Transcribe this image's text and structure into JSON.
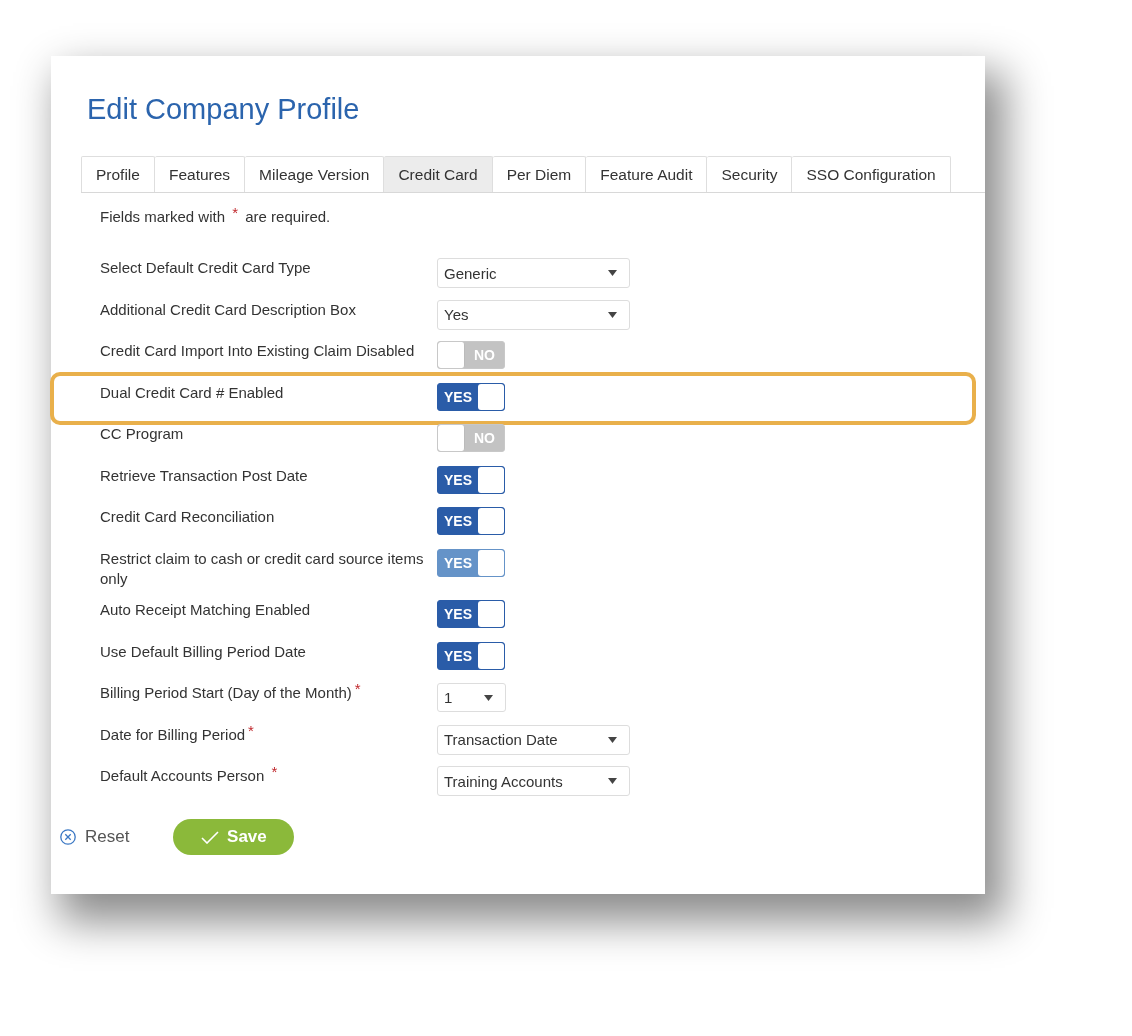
{
  "title": "Edit Company Profile",
  "tabs": [
    {
      "label": "Profile",
      "selected": false
    },
    {
      "label": "Features",
      "selected": false
    },
    {
      "label": "Mileage Version",
      "selected": false
    },
    {
      "label": "Credit Card",
      "selected": true
    },
    {
      "label": "Per Diem",
      "selected": false
    },
    {
      "label": "Feature Audit",
      "selected": false
    },
    {
      "label": "Security",
      "selected": false
    },
    {
      "label": "SSO Configuration",
      "selected": false
    }
  ],
  "note": "Fields marked with $^{*}$ are required.",
  "rows": [
    {
      "kind": "select",
      "label": "Select Default Credit Card Type",
      "value": "Generic",
      "highlighted": false
    },
    {
      "kind": "select",
      "label": "Additional Credit Card Description Box",
      "value": "Yes",
      "highlighted": false
    },
    {
      "kind": "toggle",
      "label": "Credit Card Import Into Existing Claim Disabled",
      "on": false,
      "disabled": false,
      "text": "NO",
      "highlighted": false
    },
    {
      "kind": "toggle",
      "label": "Dual Credit Card # Enabled",
      "on": true,
      "disabled": false,
      "text": "YES",
      "highlighted": true
    },
    {
      "kind": "toggle",
      "label": "CC Program",
      "on": false,
      "disabled": false,
      "text": "NO",
      "highlighted": false
    },
    {
      "kind": "toggle",
      "label": "Retrieve Transaction Post Date",
      "on": true,
      "disabled": false,
      "text": "YES",
      "highlighted": false
    },
    {
      "kind": "toggle",
      "label": "Credit Card Reconciliation",
      "on": true,
      "disabled": false,
      "text": "YES",
      "highlighted": false
    },
    {
      "kind": "toggle",
      "label": "Restrict claim to cash or credit card source items only",
      "on": true,
      "disabled": true,
      "text": "YES",
      "highlighted": false
    },
    {
      "kind": "toggle",
      "label": "Auto Receipt Matching Enabled",
      "on": true,
      "disabled": false,
      "text": "YES",
      "highlighted": false
    },
    {
      "kind": "toggle",
      "label": "Use Default Billing Period Date",
      "on": true,
      "disabled": false,
      "text": "YES",
      "highlighted": false
    },
    {
      "kind": "number-select",
      "label": "Billing Period Start (Day of the Month)$^{*}$",
      "value": "1",
      "highlighted": false
    },
    {
      "kind": "select",
      "label": "Date for Billing Period$^{*}$",
      "value": "Transaction Date",
      "highlighted": false
    },
    {
      "kind": "select",
      "label": "Default Accounts Person $^{*}$",
      "value": "Training Accounts",
      "highlighted": false
    }
  ],
  "actions": {
    "reset": "Reset",
    "save": "Save"
  }
}
